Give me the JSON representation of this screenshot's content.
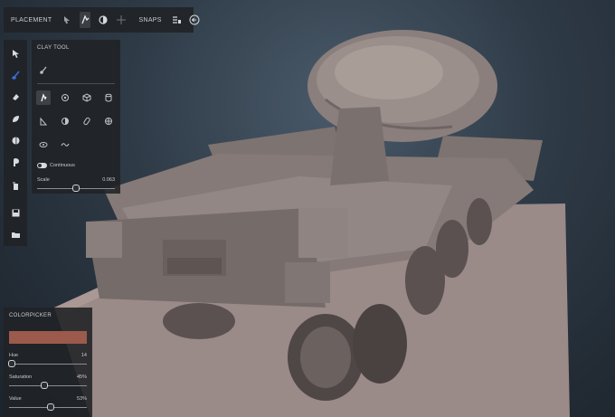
{
  "toolbar": {
    "placement_label": "PLACEMENT",
    "snaps_label": "SNAPS",
    "icons": [
      "pointer-icon",
      "transform-icon",
      "sphere-icon",
      "crosshair-icon",
      "list-icon",
      "back-arrow-icon"
    ]
  },
  "left_tools": [
    "select-arrow-icon",
    "brush-icon",
    "eraser-icon",
    "flatten-icon",
    "fill-icon",
    "paint-icon",
    "export-icon",
    "save-icon",
    "folder-icon"
  ],
  "clay_tool": {
    "title": "CLAY TOOL",
    "continuous_label": "Continuous",
    "continuous_on": true,
    "scale_label": "Scale",
    "scale_value": "0.063",
    "scale_fraction": 0.5
  },
  "colorpicker": {
    "title": "COLORPICKER",
    "color": "#9b5a4c",
    "hue_label": "Hue",
    "hue_value": "14",
    "hue_fraction": 0.04,
    "saturation_label": "Saturation",
    "saturation_value": "45%",
    "saturation_fraction": 0.45,
    "value_label": "Value",
    "value_value": "53%",
    "value_fraction": 0.53
  },
  "colors": {
    "accent": "#3b6fd6",
    "panel": "#202226",
    "model": "#8b7f7c",
    "ground": "#9a8a88"
  }
}
